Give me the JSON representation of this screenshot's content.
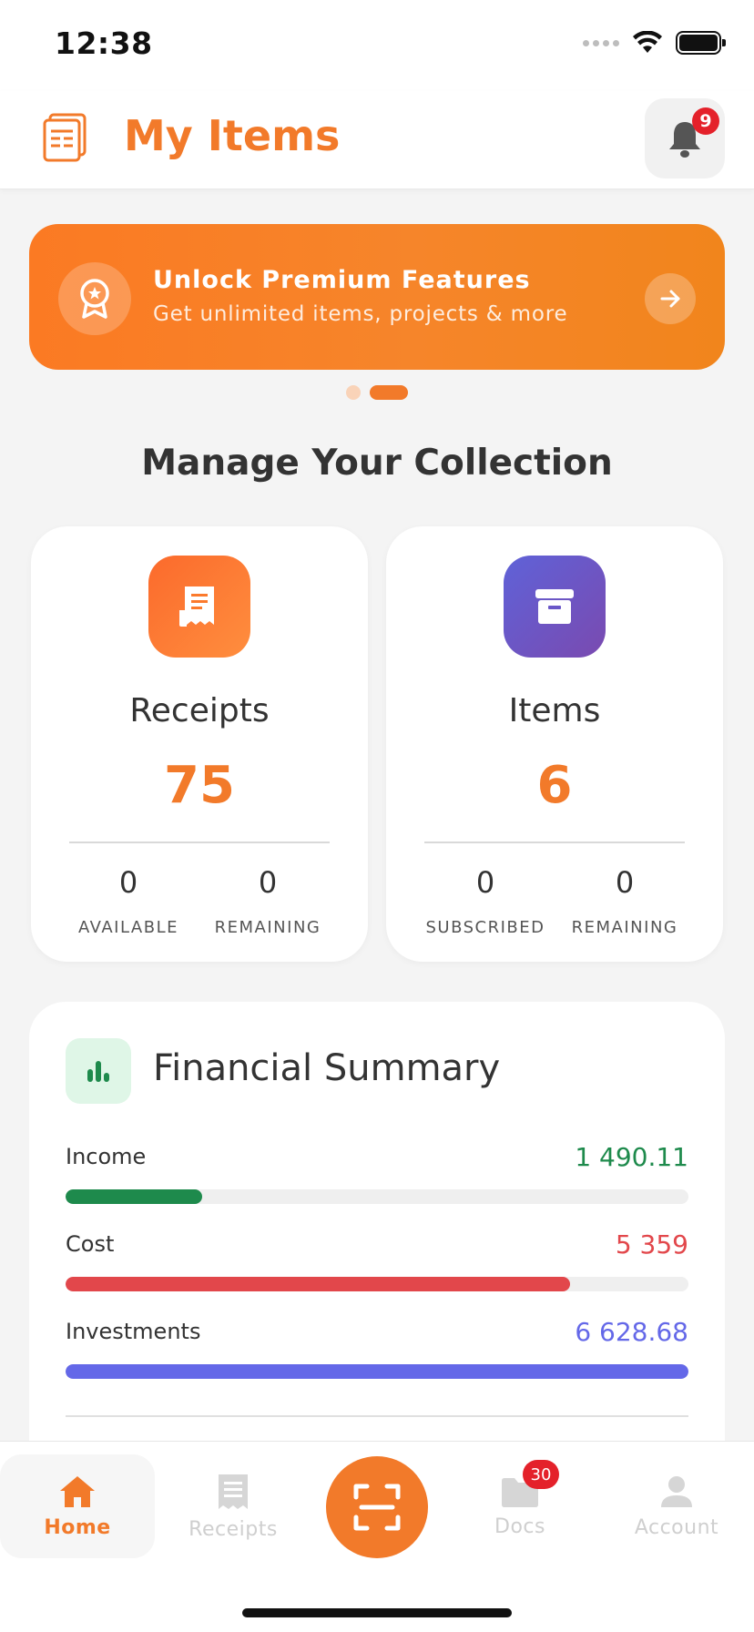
{
  "status_bar": {
    "time": "12:38"
  },
  "header": {
    "title": "My Items",
    "notification_count": "9"
  },
  "banner": {
    "title": "Unlock Premium Features",
    "subtitle": "Get unlimited items, projects & more"
  },
  "section": {
    "title": "Manage Your Collection"
  },
  "cards": [
    {
      "label": "Receipts",
      "value": "75",
      "stats": [
        {
          "num": "0",
          "label": "AVAILABLE"
        },
        {
          "num": "0",
          "label": "REMAINING"
        }
      ]
    },
    {
      "label": "Items",
      "value": "6",
      "stats": [
        {
          "num": "0",
          "label": "SUBSCRIBED"
        },
        {
          "num": "0",
          "label": "REMAINING"
        }
      ]
    }
  ],
  "financial": {
    "title": "Financial Summary",
    "rows": [
      {
        "label": "Income",
        "value": "1 490.11",
        "color": "#1e8a4c",
        "fraction": 0.22
      },
      {
        "label": "Cost",
        "value": "5 359",
        "color": "#e2474b",
        "fraction": 0.81
      },
      {
        "label": "Investments",
        "value": "6 628.68",
        "color": "#6468e8",
        "fraction": 1.0
      }
    ]
  },
  "tabbar": {
    "home": "Home",
    "receipts": "Receipts",
    "docs": "Docs",
    "docs_badge": "30",
    "account": "Account"
  },
  "colors": {
    "accent": "#f27a2a",
    "badge": "#e4212a"
  }
}
